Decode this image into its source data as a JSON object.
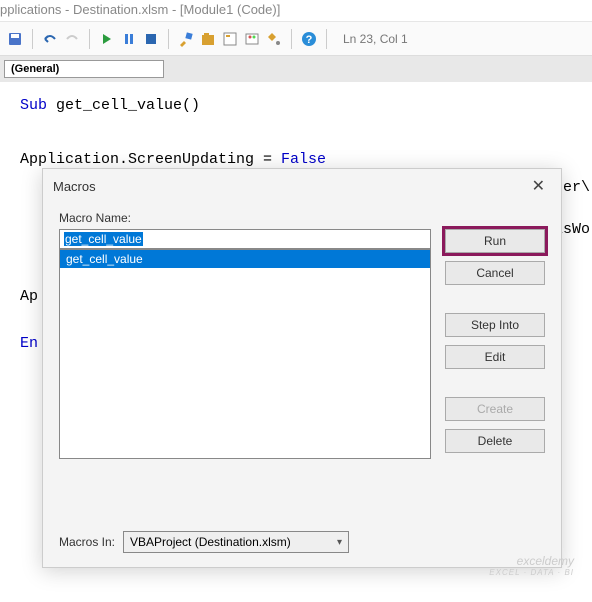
{
  "title": "pplications - Destination.xlsm - [Module1 (Code)]",
  "cursor": "Ln 23, Col 1",
  "general_dropdown": "(General)",
  "code": {
    "l1_kw": "Sub",
    "l1_rest": " get_cell_value()",
    "l2_pre": "Application.ScreenUpdating = ",
    "l2_kw": "False",
    "partial1": "ser\\",
    "partial2": "isWo",
    "ap": "Ap",
    "en": "En"
  },
  "dialog": {
    "title": "Macros",
    "macro_name_label": "Macro Name:",
    "macro_input": "get_cell_value",
    "macro_list_item": "get_cell_value",
    "macros_in_label": "Macros In:",
    "macros_in_value": "VBAProject (Destination.xlsm)",
    "buttons": {
      "run": "Run",
      "cancel": "Cancel",
      "step_into": "Step Into",
      "edit": "Edit",
      "create": "Create",
      "delete": "Delete"
    }
  },
  "watermark": {
    "l1": "exceldemy",
    "l2": "EXCEL · DATA · BI"
  }
}
